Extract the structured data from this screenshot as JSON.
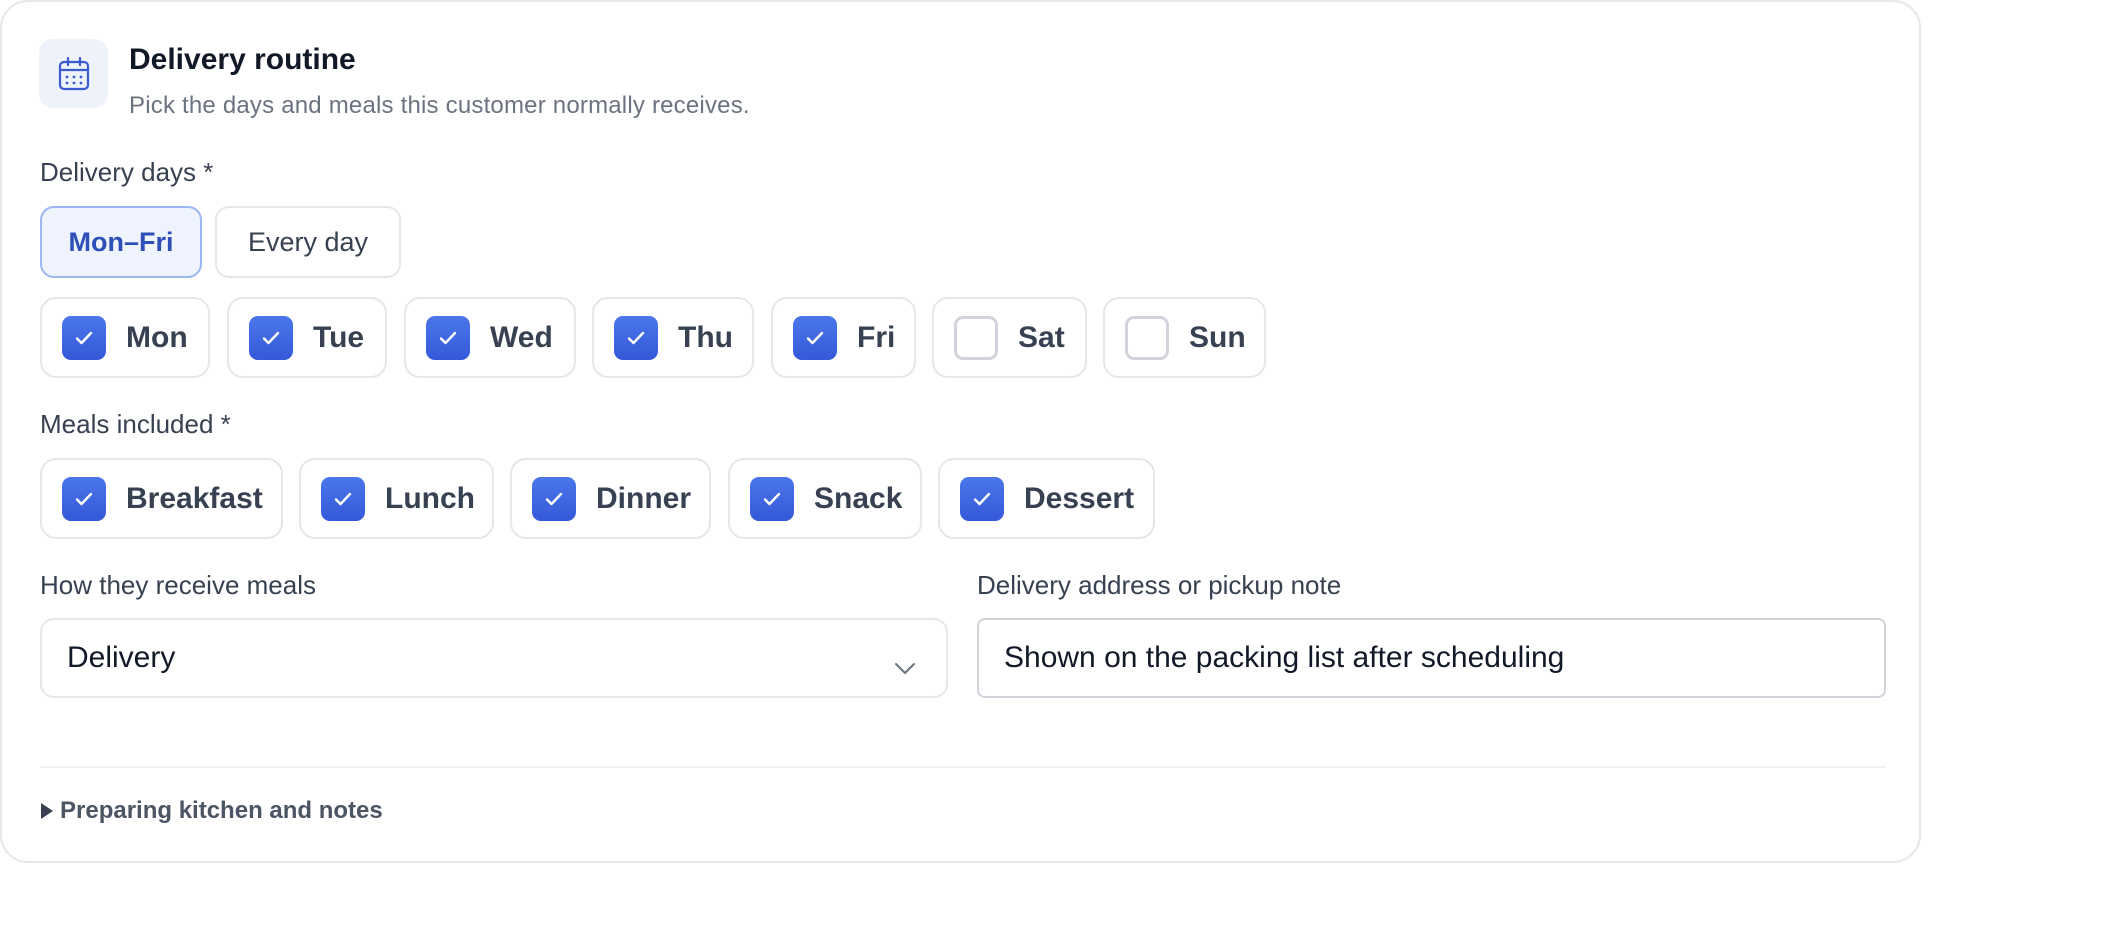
{
  "card": {
    "title": "Delivery routine",
    "subtitle": "Pick the days and meals this customer normally receives.",
    "icon": "calendar-icon"
  },
  "delivery_days": {
    "label": "Delivery days *",
    "presets": [
      {
        "label": "Mon–Fri",
        "active": true
      },
      {
        "label": "Every day",
        "active": false
      }
    ],
    "days": [
      {
        "label": "Mon",
        "checked": true
      },
      {
        "label": "Tue",
        "checked": true
      },
      {
        "label": "Wed",
        "checked": true
      },
      {
        "label": "Thu",
        "checked": true
      },
      {
        "label": "Fri",
        "checked": true
      },
      {
        "label": "Sat",
        "checked": false
      },
      {
        "label": "Sun",
        "checked": false
      }
    ]
  },
  "meals": {
    "label": "Meals included *",
    "items": [
      {
        "label": "Breakfast",
        "checked": true
      },
      {
        "label": "Lunch",
        "checked": true
      },
      {
        "label": "Dinner",
        "checked": true
      },
      {
        "label": "Snack",
        "checked": true
      },
      {
        "label": "Dessert",
        "checked": true
      }
    ]
  },
  "receive": {
    "label": "How they receive meals",
    "value": "Delivery",
    "icon": "chevron-down-icon"
  },
  "address": {
    "label": "Delivery address or pickup note",
    "placeholder": "Shown on the packing list after scheduling"
  },
  "details": {
    "label": "Preparing kitchen and notes",
    "icon": "disclosure-triangle-icon"
  },
  "colors": {
    "accent": "#3559d9",
    "accent_light": "#eef3fd",
    "border": "#e5e7eb"
  }
}
